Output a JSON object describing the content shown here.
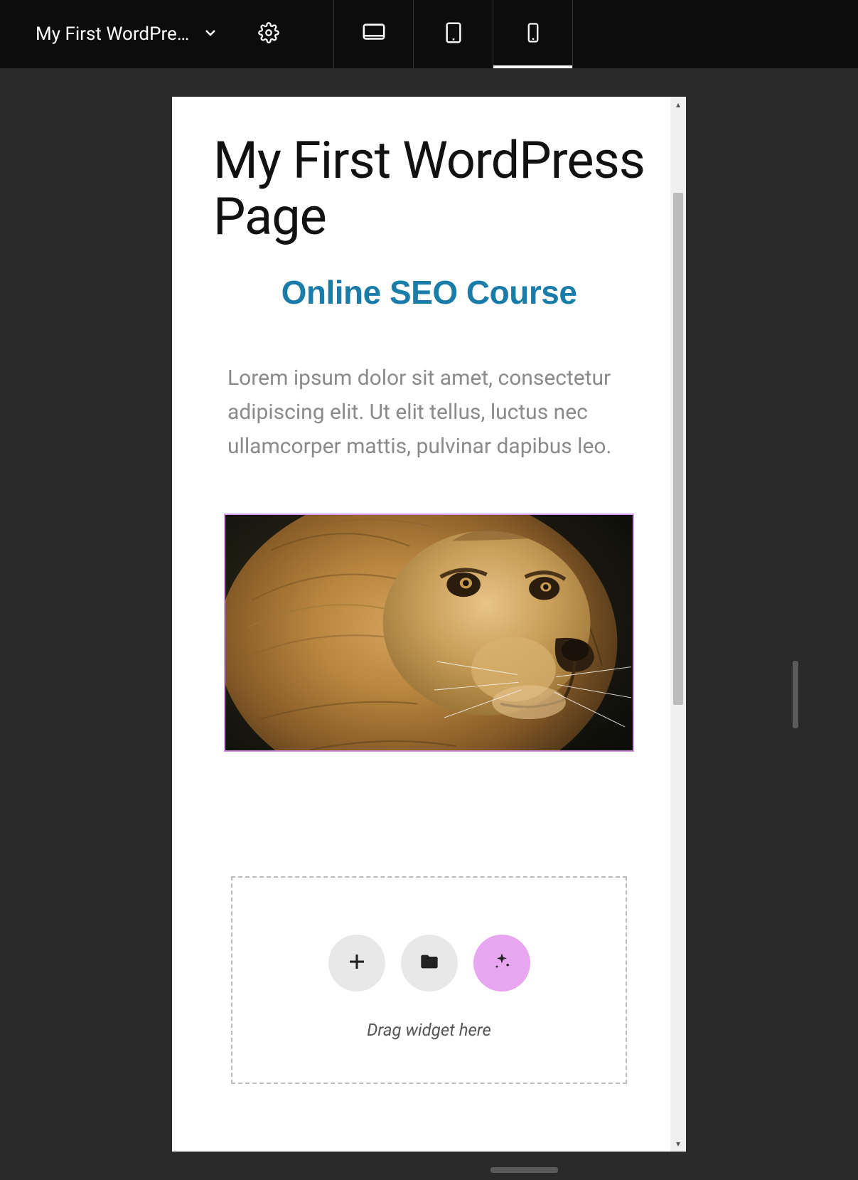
{
  "header": {
    "title_truncated": "My First WordPre…",
    "devices": [
      "desktop",
      "tablet",
      "mobile"
    ],
    "active_device": "mobile"
  },
  "page": {
    "heading": "My First WordPress Page",
    "seo_title": "Online SEO Course",
    "paragraph": "Lorem ipsum dolor sit amet, consectetur adipiscing elit. Ut elit tellus, luctus nec ullamcorper mattis, pulvinar dapibus leo.",
    "image_alt": "lion"
  },
  "dropzone": {
    "hint": "Drag widget here"
  }
}
